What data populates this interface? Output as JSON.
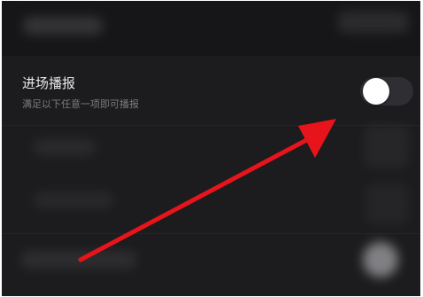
{
  "settings": {
    "entry_broadcast": {
      "title": "进场播报",
      "subtitle": "满足以下任意一项即可播报",
      "enabled": false
    }
  },
  "colors": {
    "background": "#1c1c1e",
    "arrow": "#e8141b",
    "toggle_track": "#2f2f33",
    "toggle_knob": "#ffffff"
  }
}
